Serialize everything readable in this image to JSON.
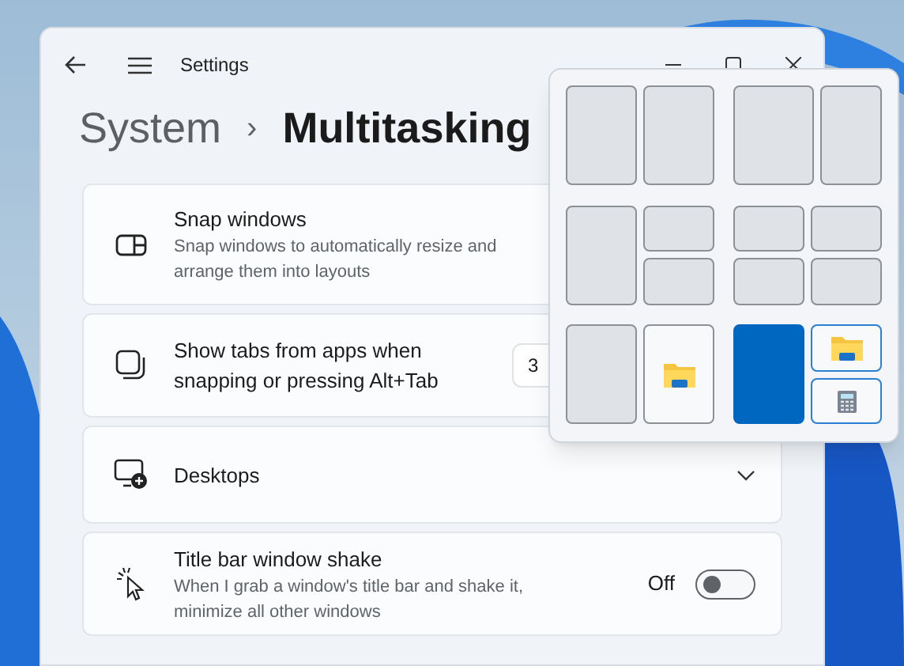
{
  "window": {
    "title": "Settings"
  },
  "breadcrumb": {
    "parent": "System",
    "separator": "›",
    "current": "Multitasking"
  },
  "settings": [
    {
      "kind": "description",
      "title": "Snap windows",
      "description": "Snap windows to automatically resize and arrange them into layouts"
    },
    {
      "kind": "dropdown",
      "title": "Show tabs from apps when snapping or pressing Alt+Tab",
      "value": "3"
    },
    {
      "kind": "expander",
      "title": "Desktops",
      "expanded": false
    },
    {
      "kind": "toggle",
      "title": "Title bar window shake",
      "description": "When I grab a window's title bar and shake it, minimize all other windows",
      "state_label": "Off",
      "on": false
    }
  ],
  "snap_layouts": [
    {
      "kind": "halves",
      "zones": [
        {
          "kind": "empty",
          "selected": false,
          "highlighted": false
        },
        {
          "kind": "empty",
          "selected": false,
          "highlighted": false
        }
      ]
    },
    {
      "kind": "wide-narrow",
      "zones": [
        {
          "kind": "empty",
          "selected": false,
          "highlighted": false
        },
        {
          "kind": "empty",
          "selected": false,
          "highlighted": false
        }
      ]
    },
    {
      "kind": "main-stack",
      "zones": [
        {
          "kind": "empty",
          "selected": false,
          "highlighted": false
        },
        {
          "kind": "empty",
          "selected": false,
          "highlighted": false
        },
        {
          "kind": "empty",
          "selected": false,
          "highlighted": false
        }
      ]
    },
    {
      "kind": "quad",
      "zones": [
        {
          "kind": "empty",
          "selected": false,
          "highlighted": false
        },
        {
          "kind": "empty",
          "selected": false,
          "highlighted": false
        },
        {
          "kind": "empty",
          "selected": false,
          "highlighted": false
        },
        {
          "kind": "empty",
          "selected": false,
          "highlighted": false
        }
      ]
    },
    {
      "kind": "halves",
      "zones": [
        {
          "kind": "empty",
          "selected": false,
          "highlighted": false
        },
        {
          "kind": "folder",
          "selected": false,
          "highlighted": false
        }
      ]
    },
    {
      "kind": "main-stack",
      "zones": [
        {
          "kind": "empty",
          "selected": true,
          "highlighted": false
        },
        {
          "kind": "folder",
          "selected": false,
          "highlighted": true
        },
        {
          "kind": "calculator",
          "selected": false,
          "highlighted": true
        }
      ]
    }
  ]
}
